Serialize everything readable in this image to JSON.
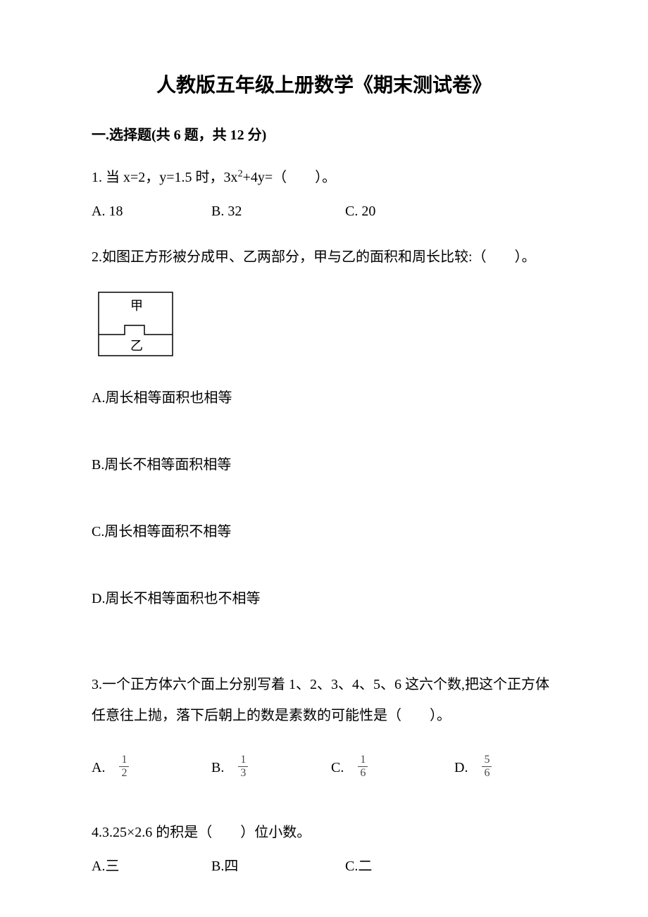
{
  "title": "人教版五年级上册数学《期末测试卷》",
  "section": "一.选择题(共 6 题，共 12 分)",
  "q1": {
    "text_prefix": "1. 当 x=2，y=1.5 时，3x",
    "text_exp": "2",
    "text_suffix": "+4y=（　　）。",
    "a": "A. 18",
    "b": "B. 32",
    "c": "C. 20"
  },
  "q2": {
    "text": "2.如图正方形被分成甲、乙两部分，甲与乙的面积和周长比较:（　　）。",
    "label_jia": "甲",
    "label_yi": "乙",
    "a": "A.周长相等面积也相等",
    "b": "B.周长不相等面积相等",
    "c": "C.周长相等面积不相等",
    "d": "D.周长不相等面积也不相等"
  },
  "q3": {
    "text": "3.一个正方体六个面上分别写着 1、2、3、4、5、6 这六个数,把这个正方体任意往上抛，落下后朝上的数是素数的可能性是（　　）。",
    "a_label": "A.",
    "a_num": "1",
    "a_den": "2",
    "b_label": "B.",
    "b_num": "1",
    "b_den": "3",
    "c_label": "C.",
    "c_num": "1",
    "c_den": "6",
    "d_label": "D.",
    "d_num": "5",
    "d_den": "6"
  },
  "q4": {
    "text": "4.3.25×2.6 的积是（　　）位小数。",
    "a": "A.三",
    "b": "B.四",
    "c": "C.二"
  }
}
